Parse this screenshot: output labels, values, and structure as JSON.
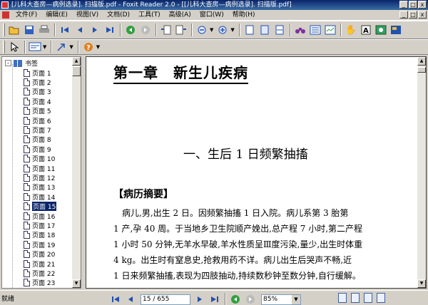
{
  "window": {
    "title": "[儿科大查房—病例选录]. 扫描版.pdf - Foxit Reader 2.0 - [[儿科大查房—病例选录]. 扫描版.pdf]",
    "min_label": "_",
    "max_label": "□",
    "close_label": "x"
  },
  "menu": [
    "文件(F)",
    "编辑(E)",
    "视图(V)",
    "文档(D)",
    "工具(T)",
    "高级(A)",
    "窗口(W)",
    "帮助(H)"
  ],
  "toolbar1": [
    "open-icon",
    "save-icon",
    "print-icon",
    "first-page-icon",
    "prev-page-icon",
    "next-page-icon",
    "last-page-icon",
    "back-icon",
    "forward-icon",
    "rotate-left-icon",
    "rotate-right-icon",
    "zoom-out-icon",
    "zoom-in-icon",
    "actual-size-icon",
    "fit-page-icon",
    "fit-width-icon",
    "binoculars-icon",
    "continuous-icon",
    "facing-icon",
    "hand-tool-icon",
    "text-select-icon",
    "snapshot-icon",
    "typewriter-icon"
  ],
  "toolbar2": [
    "select-tool-icon",
    "annotation-icon",
    "arrow-tool-icon",
    "help-icon"
  ],
  "sidebar": {
    "root_label": "书签",
    "items": [
      "页面 1",
      "页面 2",
      "页面 3",
      "页面 4",
      "页面 5",
      "页面 6",
      "页面 7",
      "页面 8",
      "页面 9",
      "页面 10",
      "页面 11",
      "页面 12",
      "页面 13",
      "页面 14",
      "页面 15",
      "页面 16",
      "页面 17",
      "页面 18",
      "页面 19",
      "页面 20",
      "页面 21",
      "页面 22",
      "页面 23"
    ],
    "selected_index": 14
  },
  "document": {
    "chapter": "第一章　新生儿疾病",
    "section": "一、生后 1 日频繁抽搐",
    "abstract_heading": "【病历摘要】",
    "lines": [
      "　病儿,男,出生 2 日。因频繁抽搐 1 日入院。病儿系第 3 胎第",
      "1 产,孕 40 周。于当地乡卫生院顺产娩出,总产程 7 小时,第二产程",
      "1 小时 50 分钟,无羊水早破,羊水性质呈Ⅲ度污染,量少,出生时体重",
      "4 kg。出生时有窒息史,抢救用药不详。病儿出生后哭声不畅,近",
      "1 日来频繁抽搐,表现为四肢抽动,持续数秒钟至数分钟,自行缓解。"
    ]
  },
  "statusbar": {
    "status": "就绪",
    "page_value": "15 / 655",
    "zoom_value": "85%"
  }
}
